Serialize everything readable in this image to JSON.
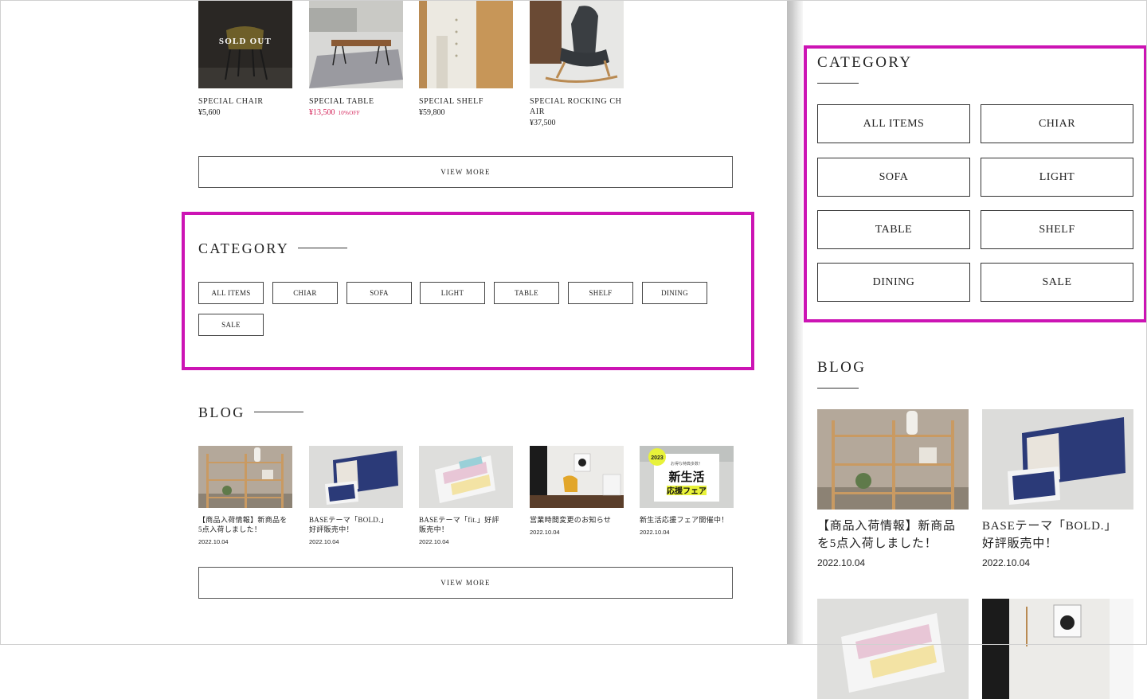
{
  "products": [
    {
      "name": "SPECIAL CHAIR",
      "price": "¥5,600",
      "overlay": "SOLD OUT",
      "badge": ""
    },
    {
      "name": "SPECIAL TABLE",
      "price": "¥13,500",
      "overlay": "",
      "badge": "10%OFF"
    },
    {
      "name": "SPECIAL SHELF",
      "price": "¥59,800",
      "overlay": "",
      "badge": ""
    },
    {
      "name": "SPECIAL ROCKING CHAIR",
      "name_line1": "SPECIAL ROCKING CH",
      "name_line2": "AIR",
      "price": "¥37,500",
      "overlay": "",
      "badge": ""
    }
  ],
  "view_more_label": "VIEW MORE",
  "category": {
    "title": "CATEGORY",
    "items": [
      "ALL ITEMS",
      "CHIAR",
      "SOFA",
      "LIGHT",
      "TABLE",
      "SHELF",
      "DINING",
      "SALE"
    ]
  },
  "blog": {
    "title": "BLOG",
    "posts": [
      {
        "title_l1": "【商品入荷情報】新商品を",
        "title_l2": "5点入荷しました！",
        "date": "2022.10.04"
      },
      {
        "title_l1": "BASEテーマ「BOLD.」",
        "title_l2": "好評販売中！",
        "date": "2022.10.04"
      },
      {
        "title_l1": "BASEテーマ「fit.」好評",
        "title_l2": "販売中！",
        "date": "2022.10.04"
      },
      {
        "title_l1": "営業時間変更のお知らせ",
        "title_l2": "",
        "date": "2022.10.04"
      },
      {
        "title_l1": "新生活応援フェア開催中！",
        "title_l2": "",
        "date": "2022.10.04"
      }
    ],
    "promo": {
      "year": "2023",
      "small": "お得な特典多数！",
      "main1": "新生活",
      "main2": "応援フェア"
    }
  },
  "colors": {
    "highlight": "#cc14b4",
    "sale_price": "#d4245a"
  },
  "right_blog_posts": [
    {
      "title_l1": "【商品入荷情報】新商品",
      "title_l2": "を5点入荷しました！",
      "date": "2022.10.04"
    },
    {
      "title_l1": "BASEテーマ「BOLD.」",
      "title_l2": "好評販売中！",
      "date": "2022.10.04"
    }
  ]
}
